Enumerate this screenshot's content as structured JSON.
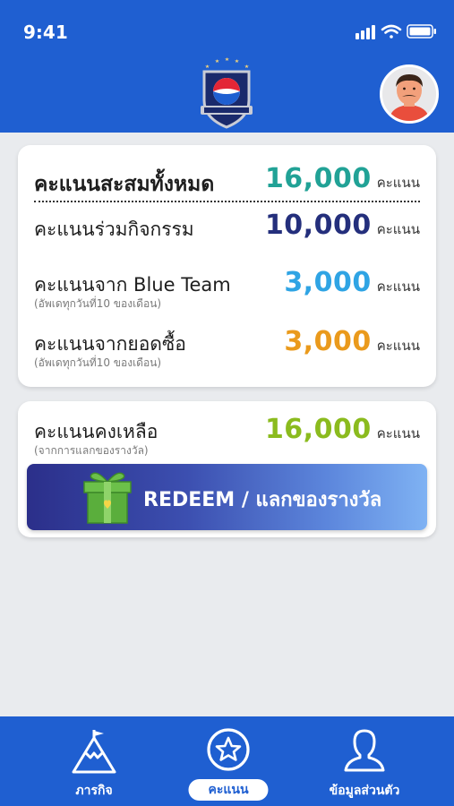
{
  "status": {
    "time": "9:41"
  },
  "colors": {
    "primary": "#1f5fd1",
    "teal": "#21a296",
    "navy": "#242f7c",
    "sky": "#2fa4e4",
    "orange": "#ea9a1c",
    "green": "#8bbb1e"
  },
  "header": {
    "logo_icon": "pepsi-team-badge-icon",
    "avatar_icon": "user-avatar-icon"
  },
  "summary": {
    "total": {
      "label": "คะแนนสะสมทั้งหมด",
      "value": "16,000",
      "unit": "คะแนน"
    },
    "items": [
      {
        "label": "คะแนนร่วมกิจกรรม",
        "sub": "",
        "value": "10,000",
        "unit": "คะแนน"
      },
      {
        "label": "คะแนนจาก Blue Team",
        "sub": "(อัพเดทุกวันที่10 ของเดือน)",
        "value": "3,000",
        "unit": "คะแนน"
      },
      {
        "label": "คะแนนจากยอดซื้อ",
        "sub": "(อัพเดทุกวันที่10 ของเดือน)",
        "value": "3,000",
        "unit": "คะแนน"
      }
    ]
  },
  "remaining": {
    "label": "คะแนนคงเหลือ",
    "sub": "(จากการแลกของรางวัล)",
    "value": "16,000",
    "unit": "คะแนน",
    "redeem_label": "REDEEM / แลกของรางวัล",
    "redeem_icon": "gift-box-icon"
  },
  "nav": [
    {
      "label": "ภารกิจ",
      "icon": "mountain-flag-icon"
    },
    {
      "label": "คะแนน",
      "icon": "star-circle-icon",
      "active": true
    },
    {
      "label": "ข้อมูลส่วนตัว",
      "icon": "person-silhouette-icon"
    }
  ]
}
